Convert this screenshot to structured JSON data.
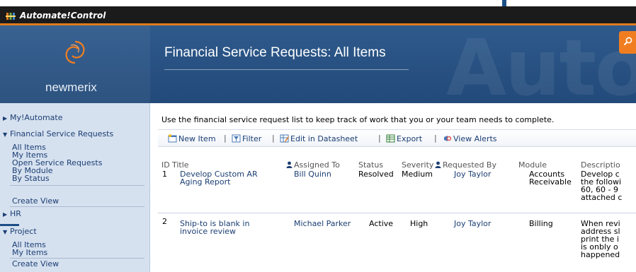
{
  "app": {
    "title": "Automate!Control"
  },
  "banner": {
    "brand": "newmerix",
    "page_title": "Financial Service Requests: All Items",
    "watermark": "Auto"
  },
  "nav": {
    "my_automate": "My!Automate",
    "financial": "Financial Service Requests",
    "financial_items": [
      "All Items",
      "My Items",
      "Open Service Requests",
      "By Module",
      "By Status"
    ],
    "create_view_1": "Create View",
    "hr": "HR",
    "project": "Project",
    "project_items": [
      "All Items",
      "My Items"
    ],
    "create_view_2": "Create View"
  },
  "content": {
    "description": "Use the financial service request list to keep track of work that you or your team needs to complete.",
    "toolbar": {
      "new_item": "New Item",
      "filter": "Filter",
      "edit_datasheet": "Edit in Datasheet",
      "export": "Export",
      "view_alerts": "View Alerts",
      "separator": "|"
    },
    "columns": [
      "ID",
      "Title",
      "Assigned To",
      "Status",
      "Severity",
      "Requested By",
      "Module",
      "Descriptio"
    ],
    "rows": [
      {
        "id": "1",
        "title": "Develop Custom AR\nAging Report",
        "assigned_to": "Bill Quinn",
        "status": "Resolved",
        "severity": "Medium",
        "requested_by": "Joy Taylor",
        "module": "Accounts\nReceivable",
        "description": "Develop c\nthe followi\n60, 60 - 9\nattached c"
      },
      {
        "id": "2",
        "title": "Ship-to is blank in\ninvoice review",
        "assigned_to": "Michael Parker",
        "status": "Active",
        "severity": "High",
        "requested_by": "Joy Taylor",
        "module": "Billing",
        "description": "When revi\naddress sl\nprint the i\nis onbly o\nhappened"
      }
    ]
  },
  "colors": {
    "banner": "#2a5586",
    "appbar": "#1b1b1b",
    "accent": "#e07b1e",
    "nav_bg": "#d6e1f0",
    "link": "#1b3e72"
  },
  "icons": [
    "app-logo-icon",
    "newmerix-swirl-icon",
    "search-icon",
    "triangle-right-icon",
    "triangle-down-icon",
    "new-item-icon",
    "filter-icon",
    "datasheet-icon",
    "export-icon",
    "alert-icon",
    "person-icon"
  ]
}
